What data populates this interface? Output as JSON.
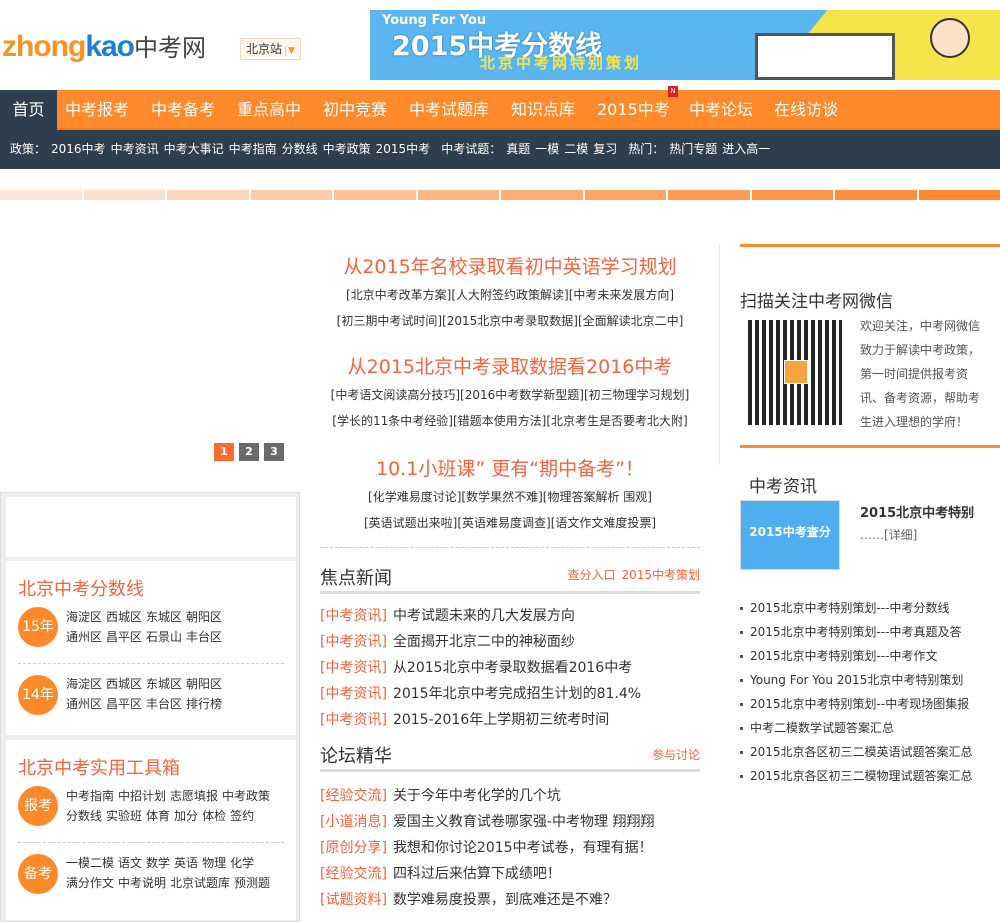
{
  "header": {
    "logo_latin_1": "zhong",
    "logo_latin_2": "kao",
    "logo_cn": "中考网",
    "city": "北京站",
    "banner": {
      "tagline": "Young For You",
      "title": "2015中考分数线",
      "subtitle": "北京中考网特别策划"
    }
  },
  "nav": {
    "items": [
      "首页",
      "中考报考",
      "中考备考",
      "重点高中",
      "初中竞赛",
      "中考试题库",
      "知识点库",
      "2015中考",
      "中考论坛",
      "在线访谈"
    ],
    "badge": "N"
  },
  "subnav": [
    "政策：",
    "2016中考",
    "中考资讯",
    "中考大事记",
    "中考指南",
    "分数线",
    "中考政策",
    "2015中考",
    "中考试题：",
    "真题",
    "一模",
    "二模",
    "复习",
    "热门：",
    "热门专题",
    "进入高一"
  ],
  "colors": {
    "accent": "#fe8a2b",
    "dark": "#2e3e4f",
    "red": "#f9623c"
  },
  "pagination": [
    "1",
    "2",
    "3"
  ],
  "left": {
    "score_title": "北京中考分数线",
    "score_groups": [
      {
        "badge": "15年",
        "row1": [
          "海淀区",
          "西城区",
          "东城区",
          "朝阳区"
        ],
        "row2": [
          "通州区",
          "昌平区",
          "石景山",
          "丰台区"
        ]
      },
      {
        "badge": "14年",
        "row1": [
          "海淀区",
          "西城区",
          "东城区",
          "朝阳区"
        ],
        "row2": [
          "通州区",
          "昌平区",
          "丰台区",
          "排行榜"
        ]
      }
    ],
    "tools_title": "北京中考实用工具箱",
    "tool_groups": [
      {
        "badge": "报考",
        "row1": [
          "中考指南",
          "中招计划",
          "志愿填报",
          "中考政策"
        ],
        "row2": [
          "分数线",
          "实验班",
          "体育",
          "加分",
          "体检",
          "签约"
        ]
      },
      {
        "badge": "备考",
        "row1": [
          "一模二模",
          "语文",
          "数学",
          "英语",
          "物理",
          "化学"
        ],
        "row2": [
          "满分作文",
          "中考说明",
          "北京试题库",
          "预测题"
        ]
      }
    ]
  },
  "center": {
    "headlines": [
      {
        "title": "从2015年名校录取看初中英语学习规划",
        "links": [
          [
            "[北京中考改革方案]",
            "[人大附签约政策解读]",
            "[中考未来发展方向]"
          ],
          [
            "[初三期中考试时间]",
            "[2015北京中考录取数据]",
            "[全面解读北京二中]"
          ]
        ]
      },
      {
        "title": "从2015北京中考录取数据看2016中考",
        "links": [
          [
            "[中考语文阅读高分技巧]",
            "[2016中考数学新型题]",
            "[初三物理学习规划]"
          ],
          [
            "[学长的11条中考经验]",
            "[错题本使用方法]",
            "[北京考生是否要考北大附]"
          ]
        ]
      },
      {
        "title": "10.1小班课”  更有“期中备考”！",
        "links": [
          [
            "[化学难易度讨论]",
            "[数学果然不难]",
            "[物理答案解析 围观]"
          ],
          [
            "[英语试题出来啦]",
            "[英语难易度调查]",
            "[语文作文难度投票]"
          ]
        ]
      }
    ],
    "focus": {
      "title": "焦点新闻",
      "links": [
        "查分入口",
        "2015中考策划"
      ],
      "items": [
        {
          "tag": "[中考资讯]",
          "text": "中考试题未来的几大发展方向"
        },
        {
          "tag": "[中考资讯]",
          "text": "全面揭开北京二中的神秘面纱"
        },
        {
          "tag": "[中考资讯]",
          "text": "从2015北京中考录取数据看2016中考"
        },
        {
          "tag": "[中考资讯]",
          "text": "2015年北京中考完成招生计划的81.4%"
        },
        {
          "tag": "[中考资讯]",
          "text": "2015-2016年上学期初三统考时间"
        }
      ]
    },
    "forum": {
      "title": "论坛精华",
      "link": "参与讨论",
      "items": [
        {
          "tag": "[经验交流]",
          "text": "关于今年中考化学的几个坑"
        },
        {
          "tag": "[小道消息]",
          "text": "爱国主义教育试卷哪家强-中考物理 翔翔翔"
        },
        {
          "tag": "[原创分享]",
          "text": "我想和你讨论2015中考试卷，有理有据！"
        },
        {
          "tag": "[经验交流]",
          "text": "四科过后来估算下成绩吧！"
        },
        {
          "tag": "[试题资料]",
          "text": "数学难易度投票，到底难还是不难？"
        }
      ]
    }
  },
  "right": {
    "wechat_title": "扫描关注中考网微信",
    "wechat_text": "欢迎关注，中考网微信致力于解读中考政策，第一时间提供报考资讯、备考资源，帮助考生进入理想的学府！",
    "news_title": "中考资讯",
    "thumb_text": "2015中考查分",
    "feature_title": "2015北京中考特别",
    "feature_more": "……",
    "feature_detail": "[详细]",
    "list": [
      "2015北京中考特别策划---中考分数线",
      "2015北京中考特别策划---中考真题及答",
      "2015北京中考特别策划---中考作文",
      "Young For You 2015北京中考特别策划",
      "2015北京中考特别策划--中考现场图集报",
      "中考二模数学试题答案汇总",
      "2015北京各区初三二模英语试题答案汇总",
      "2015北京各区初三二模物理试题答案汇总"
    ]
  }
}
